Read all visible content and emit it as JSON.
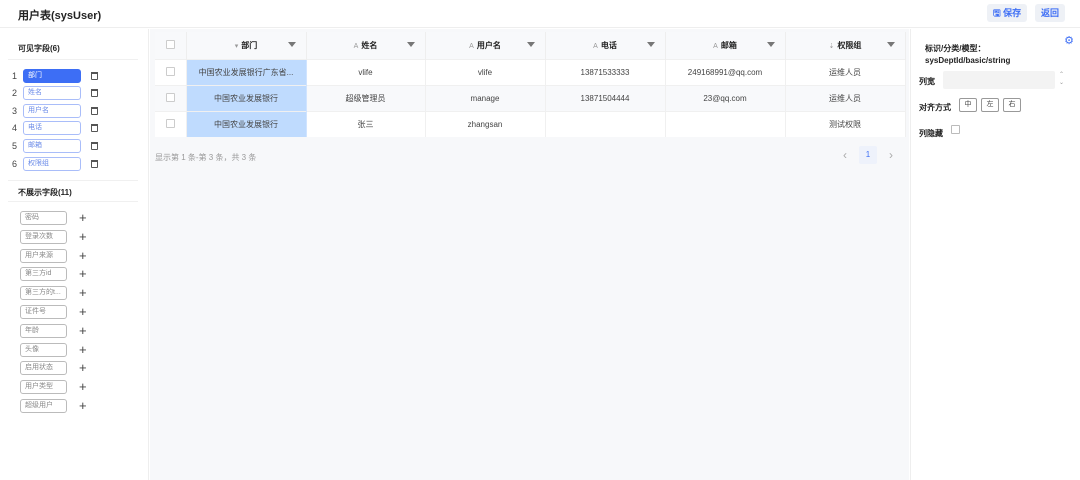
{
  "header": {
    "title": "用户表(sysUser)",
    "save_label": "保存",
    "back_label": "返回"
  },
  "left": {
    "visible_title": "可见字段(6)",
    "visible_fields": [
      {
        "num": "1",
        "label": "部门"
      },
      {
        "num": "2",
        "label": "姓名"
      },
      {
        "num": "3",
        "label": "用户名"
      },
      {
        "num": "4",
        "label": "电话"
      },
      {
        "num": "5",
        "label": "邮箱"
      },
      {
        "num": "6",
        "label": "权限组"
      }
    ],
    "hidden_title": "不展示字段(11)",
    "hidden_fields": [
      "密码",
      "登录次数",
      "用户来源",
      "第三方id",
      "第三方的t...",
      "证件号",
      "年龄",
      "头像",
      "启用状态",
      "用户类型",
      "超级用户"
    ]
  },
  "table": {
    "columns": [
      {
        "type": "▾",
        "label": "部门"
      },
      {
        "type": "A",
        "label": "姓名"
      },
      {
        "type": "A",
        "label": "用户名"
      },
      {
        "type": "A",
        "label": "电话"
      },
      {
        "type": "A",
        "label": "邮箱"
      },
      {
        "type": "⇣",
        "label": "权限组"
      }
    ],
    "rows": [
      [
        "中国农业发展银行广东省...",
        "vlife",
        "vlife",
        "13871533333",
        "249168991@qq.com",
        "运维人员"
      ],
      [
        "中国农业发展银行",
        "超级管理员",
        "manage",
        "13871504444",
        "23@qq.com",
        "运维人员"
      ],
      [
        "中国农业发展银行",
        "张三",
        "zhangsan",
        "",
        "",
        "测试权限"
      ]
    ],
    "pagination_info": "显示第 1 条-第 3 条，共 3 条",
    "current_page": "1"
  },
  "right": {
    "ident_label": "标识/分类/模型：",
    "ident_value": "sysDeptId/basic/string",
    "width_label": "列宽",
    "align_label": "对齐方式",
    "align_options": [
      "中",
      "左",
      "右"
    ],
    "hide_label": "列隐藏"
  },
  "colors": {
    "accent": "#3d6ef5",
    "highlight": "#bfdbfe"
  }
}
